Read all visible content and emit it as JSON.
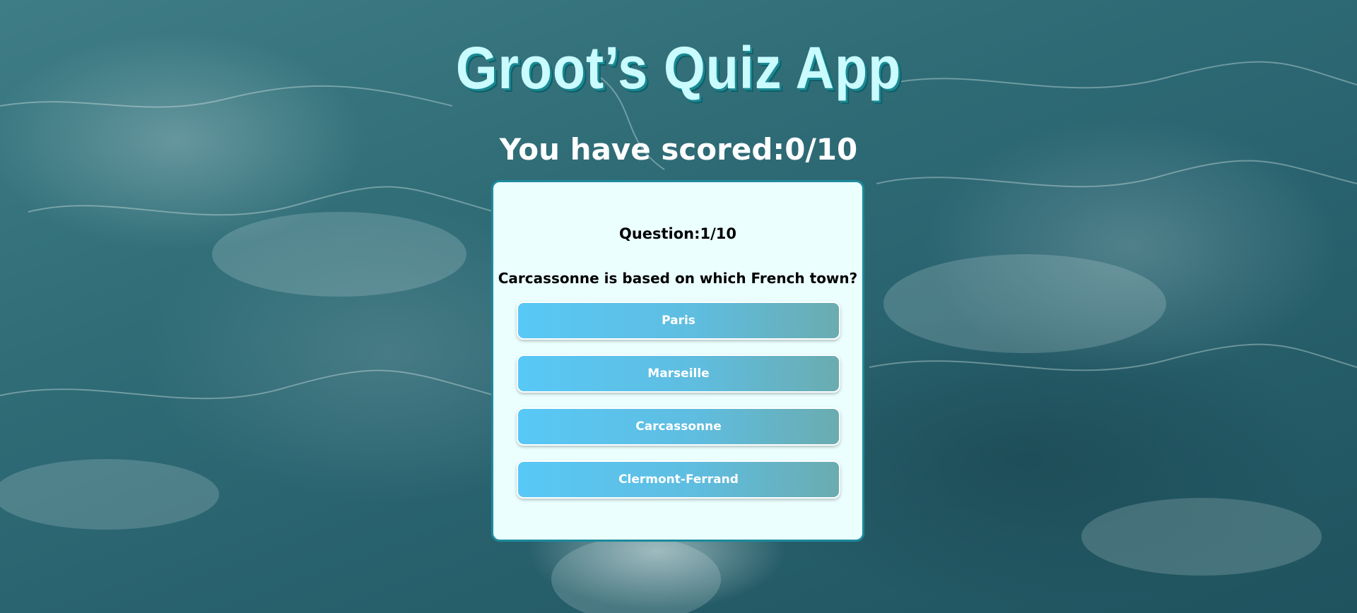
{
  "app": {
    "title": "Groot’s Quiz App"
  },
  "score": {
    "label": "You have scored:",
    "value": "0/10"
  },
  "quiz": {
    "question_counter": "Question:1/10",
    "question": "Carcassonne is based on which French town?",
    "answers": [
      {
        "label": "Paris"
      },
      {
        "label": "Marseille"
      },
      {
        "label": "Carcassonne"
      },
      {
        "label": "Clermont-Ferrand"
      }
    ]
  },
  "colors": {
    "title_fill": "#c9fbff",
    "title_shadow": "#1a8a94",
    "card_background": "#ebffff",
    "card_border": "#1c8a9c",
    "button_gradient_start": "#58c8f6",
    "button_gradient_end": "#6aacb0",
    "background_sea": "#2f6c76"
  },
  "background": {
    "description_icon": "ocean-waves-background"
  }
}
